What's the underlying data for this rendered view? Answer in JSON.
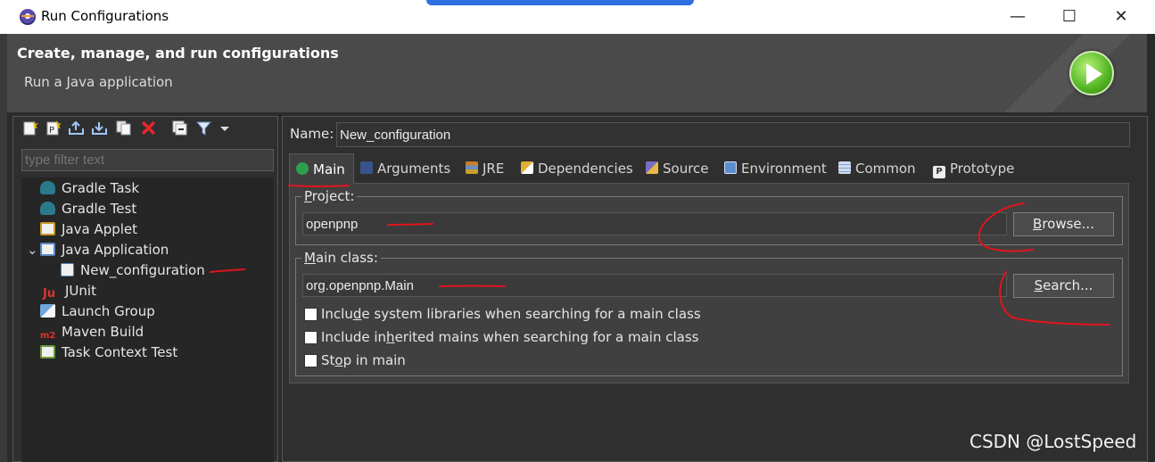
{
  "window": {
    "title": "Run Configurations",
    "controls": {
      "minimize": "—",
      "maximize": "☐",
      "close": "✕"
    }
  },
  "header": {
    "title": "Create, manage, and run configurations",
    "subtitle": "Run a Java application"
  },
  "left_panel": {
    "toolbar": [
      "new-configuration-icon",
      "new-prototype-icon",
      "export-icon",
      "import-icon",
      "duplicate-icon",
      "delete-icon",
      "collapse-all-icon",
      "filter-icon",
      "view-menu-icon"
    ],
    "filter_placeholder": "type filter text",
    "tree": [
      {
        "label": "Gradle Task",
        "icon": "gradle-icon"
      },
      {
        "label": "Gradle Test",
        "icon": "gradle-icon"
      },
      {
        "label": "Java Applet",
        "icon": "java-applet-icon"
      },
      {
        "label": "Java Application",
        "icon": "java-application-icon",
        "expanded": true
      },
      {
        "label": "New_configuration",
        "icon": "java-class-icon",
        "selected": true
      },
      {
        "label": "JUnit",
        "icon": "junit-icon"
      },
      {
        "label": "Launch Group",
        "icon": "launch-group-icon"
      },
      {
        "label": "Maven Build",
        "icon": "maven-icon"
      },
      {
        "label": "Task Context Test",
        "icon": "task-context-icon"
      }
    ]
  },
  "config": {
    "name_label": "Name:",
    "name_value": "New_configuration",
    "tabs": [
      {
        "label": "Main",
        "icon": "main-class-icon",
        "active": true
      },
      {
        "label": "Arguments",
        "icon": "arguments-icon"
      },
      {
        "label": "JRE",
        "icon": "jre-icon"
      },
      {
        "label": "Dependencies",
        "icon": "dependencies-icon"
      },
      {
        "label": "Source",
        "icon": "source-icon"
      },
      {
        "label": "Environment",
        "icon": "environment-icon"
      },
      {
        "label": "Common",
        "icon": "common-icon"
      },
      {
        "label": "Prototype",
        "icon": "prototype-icon"
      }
    ],
    "project": {
      "legend_mnemonic": "P",
      "legend_rest": "roject:",
      "value": "openpnp",
      "button_mnemonic": "B",
      "button_rest": "rowse..."
    },
    "main_class": {
      "legend_mnemonic": "M",
      "legend_rest": "ain class:",
      "value": "org.openpnp.Main",
      "button_mnemonic": "S",
      "button_rest": "earch..."
    },
    "checkboxes": [
      {
        "pre": "Inclu",
        "mnemonic": "d",
        "post": "e system libraries when searching for a main class",
        "checked": false
      },
      {
        "pre": "Include in",
        "mnemonic": "h",
        "post": "erited mains when searching for a main class",
        "checked": false
      },
      {
        "pre": "St",
        "mnemonic": "o",
        "post": "p in main",
        "checked": false
      }
    ]
  },
  "watermark": "CSDN @LostSpeed",
  "colors": {
    "header_bg": "#4a4a4a",
    "panel_bg": "#2f2f2f",
    "annotation_ink": "#e0141e",
    "run_green": "#52b521"
  }
}
